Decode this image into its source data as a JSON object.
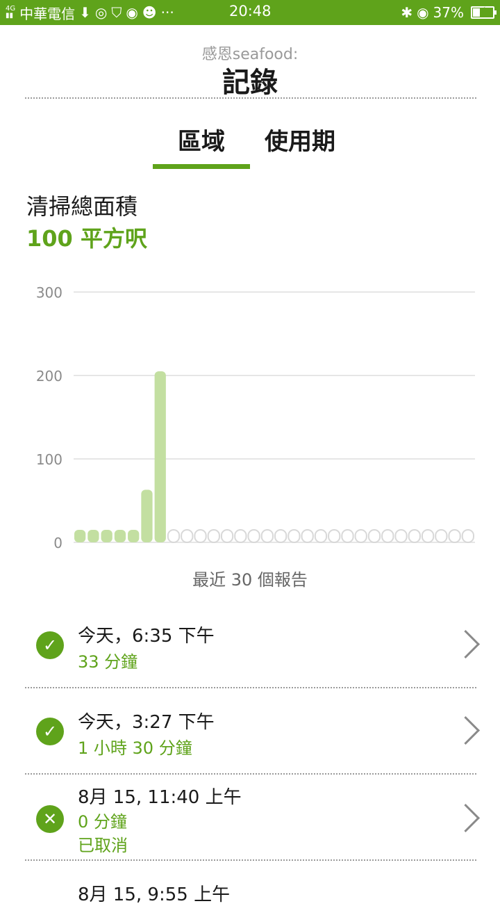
{
  "status_bar": {
    "network": "4G",
    "carrier": "中華電信",
    "time": "20:48",
    "battery": "37%",
    "battery_level": 0.37,
    "icons": [
      "download-icon",
      "instagram-icon",
      "shield-icon",
      "vpn-icon",
      "android-icon",
      "more-icon",
      "bluetooth-icon",
      "eye-icon"
    ]
  },
  "header": {
    "subtitle": "感恩seafood:",
    "title": "記錄"
  },
  "tabs": [
    {
      "label": "區域",
      "active": true
    },
    {
      "label": "使用期",
      "active": false
    }
  ],
  "stat": {
    "label": "清掃總面積",
    "value": "100 平方呎"
  },
  "chart_data": {
    "type": "bar",
    "categories": [
      "1",
      "2",
      "3",
      "4",
      "5",
      "6",
      "7",
      "8",
      "9",
      "10",
      "11",
      "12",
      "13",
      "14",
      "15",
      "16",
      "17",
      "18",
      "19",
      "20",
      "21",
      "22",
      "23",
      "24",
      "25",
      "26",
      "27",
      "28",
      "29",
      "30"
    ],
    "values": [
      15,
      15,
      15,
      15,
      15,
      63,
      205,
      0,
      0,
      0,
      0,
      0,
      0,
      0,
      0,
      0,
      0,
      0,
      0,
      0,
      0,
      0,
      0,
      0,
      0,
      0,
      0,
      0,
      0,
      0
    ],
    "yticks": [
      "0",
      "100",
      "200",
      "300"
    ],
    "ylim": [
      0,
      300
    ],
    "grid": true,
    "bar_color": "#c3dfa1",
    "empty_color": "#d8d8d8"
  },
  "chart_caption": "最近 30 個報告",
  "records": [
    {
      "time": "今天，6:35 下午",
      "duration": "33 分鐘",
      "status_text": "",
      "icon": "check-icon",
      "symbol": "✓"
    },
    {
      "time": "今天，3:27 下午",
      "duration": "1 小時 30 分鐘",
      "status_text": "",
      "icon": "check-icon",
      "symbol": "✓"
    },
    {
      "time": "8月 15, 11:40 上午",
      "duration": "0 分鐘",
      "status_text": "已取消",
      "icon": "close-icon",
      "symbol": "✕"
    },
    {
      "time": "8月 15, 9:55 上午",
      "duration": "",
      "status_text": "",
      "icon": "check-icon",
      "symbol": "✓"
    }
  ],
  "colors": {
    "accent": "#5fa31b",
    "divider": "#9a9a9a"
  }
}
